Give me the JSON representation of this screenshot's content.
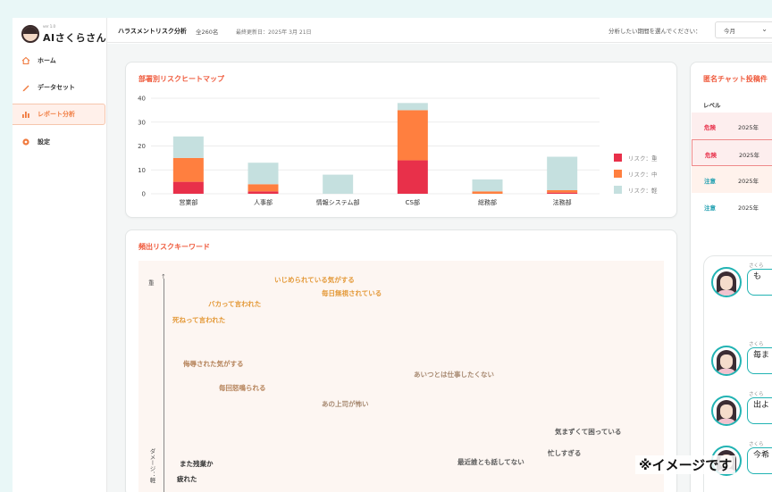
{
  "logo": {
    "version": "ver 1.0",
    "name": "AIさくらさん"
  },
  "sidebar": {
    "items": [
      {
        "label": "ホーム",
        "icon": "home-icon"
      },
      {
        "label": "データセット",
        "icon": "pencil-icon"
      },
      {
        "label": "レポート分析",
        "icon": "bar-chart-icon",
        "active": true
      },
      {
        "label": "設定",
        "icon": "gear-icon"
      }
    ]
  },
  "header": {
    "title": "ハラスメントリスク分析",
    "count": "全260名",
    "updated": "最終更新日：2025年 3月 21日",
    "period_label": "分析したい期間を選んでください：",
    "period_value": "今月"
  },
  "heatmap": {
    "title": "部署別リスクヒートマップ"
  },
  "chart_data": {
    "type": "bar",
    "stacked": true,
    "categories": [
      "営業部",
      "人事部",
      "情報システム部",
      "CS部",
      "総務部",
      "法務部"
    ],
    "series": [
      {
        "name": "リスク：重",
        "color": "#e8304a",
        "values": [
          5,
          1,
          0,
          14,
          0,
          0.5
        ]
      },
      {
        "name": "リスク：中",
        "color": "#ff7f3f",
        "values": [
          10,
          3,
          0,
          21,
          1,
          1
        ]
      },
      {
        "name": "リスク：軽",
        "color": "#c5e0df",
        "values": [
          9,
          9,
          8,
          3,
          5,
          14
        ]
      }
    ],
    "y_ticks": [
      0,
      10,
      20,
      30,
      40
    ],
    "ylim": [
      0,
      40
    ],
    "grid": true,
    "legend": "right"
  },
  "keywords": {
    "title": "頻出リスクキーワード",
    "axis_top": "重",
    "axis_side": "ダメージ：軽",
    "items": [
      {
        "text": "いじめられている気がする",
        "color": "#e49a3a"
      },
      {
        "text": "毎日無視されている",
        "color": "#e49a3a"
      },
      {
        "text": "バカって言われた",
        "color": "#e49a3a"
      },
      {
        "text": "死ねって言われた",
        "color": "#e49a3a"
      },
      {
        "text": "侮辱された気がする",
        "color": "#b5835a"
      },
      {
        "text": "あいつとは仕事したくない",
        "color": "#a88a72"
      },
      {
        "text": "毎回怒鳴られる",
        "color": "#b5835a"
      },
      {
        "text": "あの上司が怖い",
        "color": "#a88a72"
      },
      {
        "text": "気まずくて困っている",
        "color": "#5b5b5b"
      },
      {
        "text": "忙しすぎる",
        "color": "#5b5b5b"
      },
      {
        "text": "また残業か",
        "color": "#333333"
      },
      {
        "text": "最近誰とも話してない",
        "color": "#5b5b5b"
      },
      {
        "text": "疲れた",
        "color": "#333333"
      }
    ]
  },
  "chat_panel": {
    "title": "匿名チャット投稿件",
    "column_level": "レベル",
    "rows": [
      {
        "level": "危険",
        "date": "2025年",
        "color": "#e8304a",
        "bg": "#fdeeee"
      },
      {
        "level": "危険",
        "date": "2025年",
        "color": "#e8304a",
        "bg": "#fdeeee"
      },
      {
        "level": "注意",
        "date": "2025年",
        "color": "#1f9fb0",
        "bg": "#fff2ec"
      },
      {
        "level": "注意",
        "date": "2025年",
        "color": "#1f9fb0",
        "bg": "#ffffff"
      }
    ],
    "messages": [
      {
        "name": "さくら",
        "text": "も"
      },
      {
        "name": "さくら",
        "text": "毎ま"
      },
      {
        "name": "さくら",
        "text": "出よ"
      },
      {
        "name": "さくら",
        "text": "今希"
      }
    ]
  },
  "watermark": "※イメージです"
}
